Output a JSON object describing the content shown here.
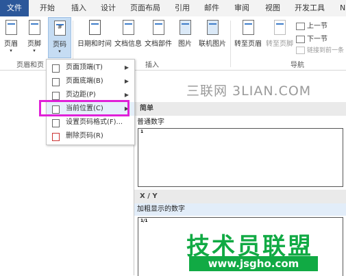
{
  "tabs": [
    {
      "label": "文件"
    },
    {
      "label": "开始"
    },
    {
      "label": "插入"
    },
    {
      "label": "设计"
    },
    {
      "label": "页面布局"
    },
    {
      "label": "引用"
    },
    {
      "label": "邮件"
    },
    {
      "label": "审阅"
    },
    {
      "label": "视图"
    },
    {
      "label": "开发工具"
    },
    {
      "label": "N"
    }
  ],
  "ribbon": {
    "header": "页眉",
    "footer": "页脚",
    "page_number": "页码",
    "date_time": "日期和时间",
    "doc_info": "文档信息",
    "doc_parts": "文档部件",
    "picture": "图片",
    "online_picture": "联机图片",
    "goto_header": "转至页眉",
    "goto_footer": "转至页脚",
    "prev": "上一节",
    "next": "下一节",
    "link_prev": "链接到前一条",
    "group_header_footer": "页眉和页",
    "group_insert": "插入",
    "group_nav": "导航"
  },
  "menu": {
    "items": [
      {
        "label": "页面顶端(T)",
        "has_submenu": true
      },
      {
        "label": "页面底端(B)",
        "has_submenu": true
      },
      {
        "label": "页边距(P)",
        "has_submenu": true
      },
      {
        "label": "当前位置(C)",
        "has_submenu": true
      },
      {
        "label": "设置页码格式(F)...",
        "has_submenu": false
      },
      {
        "label": "删除页码(R)",
        "has_submenu": false
      }
    ]
  },
  "gallery": {
    "sec1_head": "简单",
    "sec1_item": "普通数字",
    "sec1_sample": "1",
    "sec2_head": "X / Y",
    "sec2_item": "加粗显示的数字",
    "sec2_sample": "1/1"
  },
  "watermarks": {
    "top": "三联网 3LIAN.COM",
    "bottom_cn": "技术员联盟",
    "bottom_url": "www.jsgho.com"
  }
}
